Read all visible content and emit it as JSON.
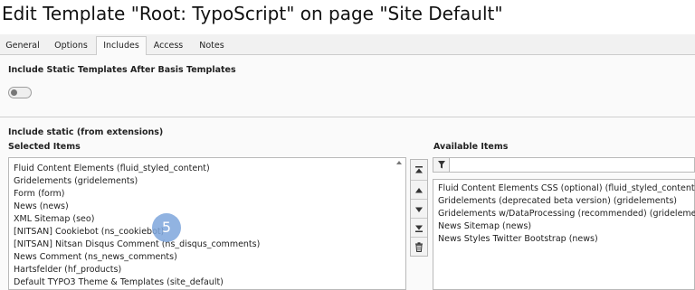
{
  "page_title": "Edit Template \"Root: TypoScript\" on page \"Site Default\"",
  "tabs": [
    {
      "label": "General"
    },
    {
      "label": "Options"
    },
    {
      "label": "Includes"
    },
    {
      "label": "Access"
    },
    {
      "label": "Notes"
    }
  ],
  "active_tab": "Includes",
  "static_templates": {
    "label": "Include Static Templates After Basis Templates",
    "checked": false
  },
  "include_static": {
    "label": "Include static (from extensions)",
    "selected_label": "Selected Items",
    "available_label": "Available Items",
    "selected_items": [
      {
        "label": "Fluid Content Elements (fluid_styled_content)"
      },
      {
        "label": "Gridelements (gridelements)"
      },
      {
        "label": "Form (form)"
      },
      {
        "label": "News (news)"
      },
      {
        "label": "XML Sitemap (seo)"
      },
      {
        "label": "[NITSAN] Cookiebot (ns_cookiebot)"
      },
      {
        "label": "[NITSAN] Nitsan Disqus Comment (ns_disqus_comments)"
      },
      {
        "label": "News Comment (ns_news_comments)"
      },
      {
        "label": "Hartsfelder (hf_products)"
      },
      {
        "label": "Default TYPO3 Theme & Templates (site_default)"
      }
    ],
    "available_items": [
      {
        "label": "Fluid Content Elements CSS (optional) (fluid_styled_content)"
      },
      {
        "label": "Gridelements (deprecated beta version) (gridelements)"
      },
      {
        "label": "Gridelements w/DataProcessing (recommended) (gridelements)"
      },
      {
        "label": "News Sitemap (news)"
      },
      {
        "label": "News Styles Twitter Bootstrap (news)"
      }
    ],
    "filter": {
      "value": "",
      "placeholder": ""
    }
  },
  "move_controls": {
    "icons": [
      "move-to-top-icon",
      "move-up-icon",
      "move-down-icon",
      "move-to-bottom-icon",
      "trash-icon"
    ]
  },
  "step_badge": "5",
  "colors": {
    "tab_bar": "#f1f1f1",
    "panel": "#fafafa",
    "badge": "#7ea6dc"
  }
}
